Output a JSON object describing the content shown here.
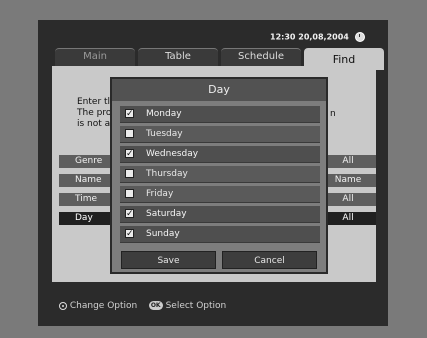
{
  "header": {
    "clock": "12:30 20,08,2004"
  },
  "tabs": [
    {
      "label": "Main"
    },
    {
      "label": "Table"
    },
    {
      "label": "Schedule"
    },
    {
      "label": "Find"
    }
  ],
  "help": {
    "lines": [
      "Enter tl",
      "The pro",
      "is not a"
    ],
    "line_end": "n"
  },
  "options": [
    {
      "label": "Genre",
      "value": "All"
    },
    {
      "label": "Name",
      "value": "Name"
    },
    {
      "label": "Time",
      "value": "All"
    },
    {
      "label": "Day",
      "value": "All"
    }
  ],
  "dialog": {
    "title": "Day",
    "check_mark": "✓",
    "days": [
      {
        "label": "Monday",
        "checked": true
      },
      {
        "label": "Tuesday",
        "checked": false
      },
      {
        "label": "Wednesday",
        "checked": true
      },
      {
        "label": "Thursday",
        "checked": false
      },
      {
        "label": "Friday",
        "checked": false
      },
      {
        "label": "Saturday",
        "checked": true
      },
      {
        "label": "Sunday",
        "checked": true
      }
    ],
    "save_label": "Save",
    "cancel_label": "Cancel"
  },
  "footer": {
    "change_label": "Change Option",
    "ok_icon_text": "OK",
    "select_label": "Select Option"
  }
}
